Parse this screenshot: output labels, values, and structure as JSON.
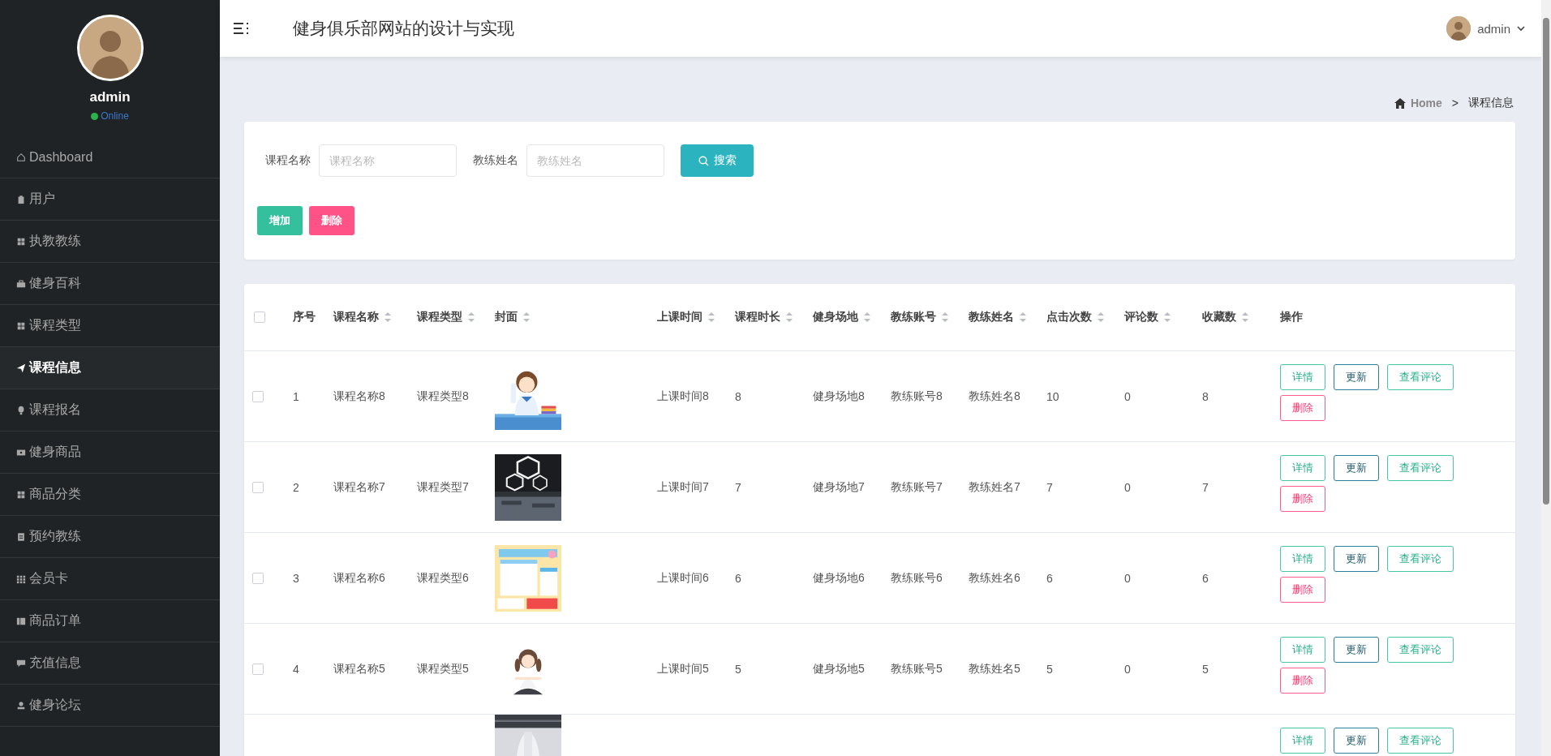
{
  "sidebar": {
    "user": {
      "name": "admin",
      "status": "Online"
    },
    "items": [
      {
        "label": "Dashboard",
        "selected": false
      },
      {
        "label": "用户",
        "selected": false
      },
      {
        "label": "执教教练",
        "selected": false
      },
      {
        "label": "健身百科",
        "selected": false
      },
      {
        "label": "课程类型",
        "selected": false
      },
      {
        "label": "课程信息",
        "selected": true
      },
      {
        "label": "课程报名",
        "selected": false
      },
      {
        "label": "健身商品",
        "selected": false
      },
      {
        "label": "商品分类",
        "selected": false
      },
      {
        "label": "预约教练",
        "selected": false
      },
      {
        "label": "会员卡",
        "selected": false
      },
      {
        "label": "商品订单",
        "selected": false
      },
      {
        "label": "充值信息",
        "selected": false
      },
      {
        "label": "健身论坛",
        "selected": false
      }
    ]
  },
  "header": {
    "title": "健身俱乐部网站的设计与实现",
    "user": "admin"
  },
  "breadcrumb": {
    "home": "Home",
    "separator": ">",
    "current": "课程信息"
  },
  "search": {
    "fields": [
      {
        "label": "课程名称",
        "placeholder": "课程名称"
      },
      {
        "label": "教练姓名",
        "placeholder": "教练姓名"
      }
    ],
    "button": "搜索"
  },
  "toolbar": [
    {
      "label": "增加",
      "kind": "add"
    },
    {
      "label": "删除",
      "kind": "delete"
    }
  ],
  "table": {
    "select_all_checked": false,
    "columns": [
      {
        "label": "序号",
        "sortable": false
      },
      {
        "label": "课程名称",
        "sortable": true
      },
      {
        "label": "课程类型",
        "sortable": true
      },
      {
        "label": "封面",
        "sortable": true
      },
      {
        "label": "上课时间",
        "sortable": true
      },
      {
        "label": "课程时长",
        "sortable": true
      },
      {
        "label": "健身场地",
        "sortable": true
      },
      {
        "label": "教练账号",
        "sortable": true
      },
      {
        "label": "教练姓名",
        "sortable": true
      },
      {
        "label": "点击次数",
        "sortable": true
      },
      {
        "label": "评论数",
        "sortable": true
      },
      {
        "label": "收藏数",
        "sortable": true
      },
      {
        "label": "操作",
        "sortable": false
      }
    ],
    "rows": [
      {
        "checked": false,
        "cells_before": [
          "1",
          "课程名称8",
          "课程类型8"
        ],
        "cover": {
          "kind": "picture"
        },
        "cells_after": [
          "上课时间8",
          "8",
          "健身场地8",
          "教练账号8",
          "教练姓名8",
          "10",
          "0",
          "8"
        ],
        "actions": [
          {
            "label": "详情",
            "kind": "detail"
          },
          {
            "label": "更新",
            "kind": "update"
          },
          {
            "label": "查看评论",
            "kind": "comments"
          },
          {
            "label": "删除",
            "kind": "delete"
          }
        ]
      },
      {
        "checked": false,
        "cells_before": [
          "2",
          "课程名称7",
          "课程类型7"
        ],
        "cover": {
          "kind": "picture"
        },
        "cells_after": [
          "上课时间7",
          "7",
          "健身场地7",
          "教练账号7",
          "教练姓名7",
          "7",
          "0",
          "7"
        ],
        "actions": [
          {
            "label": "详情",
            "kind": "detail"
          },
          {
            "label": "更新",
            "kind": "update"
          },
          {
            "label": "查看评论",
            "kind": "comments"
          },
          {
            "label": "删除",
            "kind": "delete"
          }
        ]
      },
      {
        "checked": false,
        "cells_before": [
          "3",
          "课程名称6",
          "课程类型6"
        ],
        "cover": {
          "kind": "picture"
        },
        "cells_after": [
          "上课时间6",
          "6",
          "健身场地6",
          "教练账号6",
          "教练姓名6",
          "6",
          "0",
          "6"
        ],
        "actions": [
          {
            "label": "详情",
            "kind": "detail"
          },
          {
            "label": "更新",
            "kind": "update"
          },
          {
            "label": "查看评论",
            "kind": "comments"
          },
          {
            "label": "删除",
            "kind": "delete"
          }
        ]
      },
      {
        "checked": false,
        "cells_before": [
          "4",
          "课程名称5",
          "课程类型5"
        ],
        "cover": {
          "kind": "picture"
        },
        "cells_after": [
          "上课时间5",
          "5",
          "健身场地5",
          "教练账号5",
          "教练姓名5",
          "5",
          "0",
          "5"
        ],
        "actions": [
          {
            "label": "详情",
            "kind": "detail"
          },
          {
            "label": "更新",
            "kind": "update"
          },
          {
            "label": "查看评论",
            "kind": "comments"
          },
          {
            "label": "删除",
            "kind": "delete"
          }
        ]
      },
      {
        "cover": {
          "kind": "picture"
        },
        "actions": [
          {
            "label": "详情",
            "kind": "detail"
          },
          {
            "label": "更新",
            "kind": "update"
          },
          {
            "label": "查看评论",
            "kind": "comments"
          }
        ]
      }
    ]
  }
}
